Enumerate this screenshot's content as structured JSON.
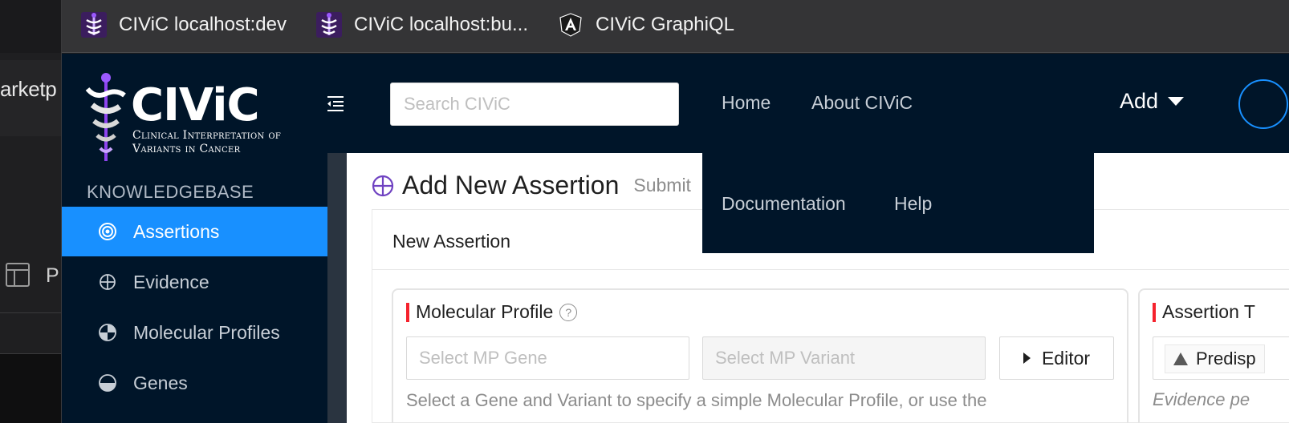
{
  "left_panel": {
    "partial_text": "arketp",
    "partial_item": "P"
  },
  "bookmarks": [
    {
      "label": "CIViC localhost:dev",
      "icon": "civic-icon"
    },
    {
      "label": "CIViC localhost:bu...",
      "icon": "civic-icon"
    },
    {
      "label": "CIViC GraphiQL",
      "icon": "angular-icon"
    }
  ],
  "logo": {
    "word": "CIViC",
    "sub_line1": "Clinical Interpretation of",
    "sub_line2": "Variants in Cancer"
  },
  "sidebar": {
    "section_label": "KNOWLEDGEBASE",
    "items": [
      {
        "label": "Assertions",
        "icon": "target-icon",
        "active": true
      },
      {
        "label": "Evidence",
        "icon": "crosshair-icon",
        "active": false
      },
      {
        "label": "Molecular Profiles",
        "icon": "pie-icon",
        "active": false
      },
      {
        "label": "Genes",
        "icon": "half-circle-icon",
        "active": false
      }
    ]
  },
  "header": {
    "search_placeholder": "Search CIViC",
    "nav": [
      "Home",
      "About CIViC"
    ],
    "add_label": "Add",
    "overflow_nav": [
      "Documentation",
      "Help"
    ]
  },
  "page": {
    "title": "Add New Assertion",
    "subtitle": "Submit",
    "card_title": "New Assertion"
  },
  "molecular_profile": {
    "label": "Molecular Profile",
    "help_glyph": "?",
    "gene_placeholder": "Select MP Gene",
    "variant_placeholder": "Select MP Variant",
    "editor_label": "Editor",
    "help_text": "Select a Gene and Variant to specify a simple Molecular Profile, or use the"
  },
  "assertion_type": {
    "label": "Assertion T",
    "selected": "Predisp",
    "help_text": "Evidence pe"
  },
  "colors": {
    "accent": "#1890ff",
    "nav_bg": "#001529",
    "required": "#f5222d"
  }
}
